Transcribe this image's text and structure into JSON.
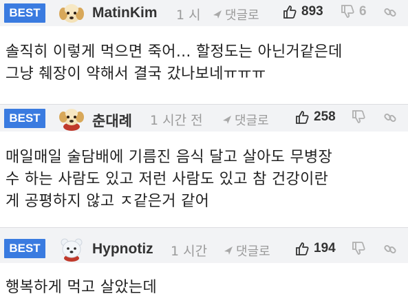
{
  "comments": [
    {
      "badge": "BEST",
      "avatar": "puppy-avatar",
      "nickname": "MatinKim",
      "time": "1 시",
      "reply_label": "댓글로",
      "likes": "893",
      "dislikes": "6",
      "lines": [
        "솔직히 이렇게 먹으면 죽어... 할정도는 아닌거같은데",
        "그냥 췌장이 약해서 결국 갔나보네ㅠㅠㅠ"
      ]
    },
    {
      "badge": "BEST",
      "avatar": "puppy-red-avatar",
      "nickname": "춘대례",
      "time": "1 시간 전",
      "reply_label": "댓글로",
      "likes": "258",
      "dislikes": "",
      "lines": [
        "매일매일 술담배에 기름진 음식 달고 살아도 무병장",
        "수 하는 사람도 있고 저런 사람도 있고 참 건강이란",
        "게 공평하지 않고 ㅈ같은거 같어"
      ]
    },
    {
      "badge": "BEST",
      "avatar": "white-bear-avatar",
      "nickname": "Hypnotiz",
      "time": "1 시간",
      "reply_label": "댓글로",
      "likes": "194",
      "dislikes": "",
      "lines": [
        "행복하게 먹고 살았는데"
      ]
    }
  ],
  "colors": {
    "badge_bg": "#3a7be0",
    "header_bg": "#f2f3f5",
    "muted": "#9a9a9a"
  }
}
